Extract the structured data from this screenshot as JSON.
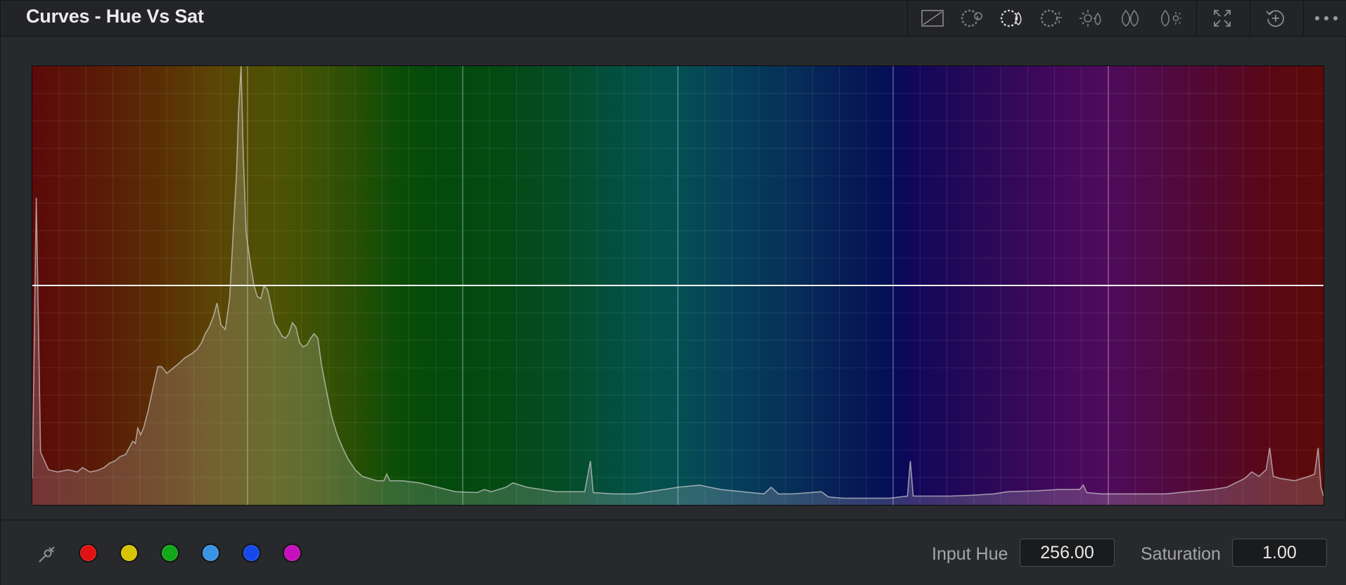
{
  "header": {
    "title": "Curves - Hue Vs Sat",
    "tools": [
      {
        "name": "curve-mode-icon"
      },
      {
        "name": "hue-wheel-icon"
      },
      {
        "name": "hue-sat-icon"
      },
      {
        "name": "hue-lum-icon"
      },
      {
        "name": "lum-sat-icon"
      },
      {
        "name": "sat-sat-icon"
      },
      {
        "name": "sat-lum-icon"
      },
      {
        "name": "expand-icon"
      },
      {
        "name": "reset-icon"
      },
      {
        "name": "more-options-icon"
      }
    ]
  },
  "graph": {
    "curve_level": 0.5,
    "hue_range": [
      0,
      360
    ],
    "grid": true,
    "histogram": [
      {
        "hue": 0,
        "v": 0.06
      },
      {
        "hue": 1.1,
        "v": 0.7
      },
      {
        "hue": 2.3,
        "v": 0.12
      },
      {
        "hue": 4.5,
        "v": 0.08
      },
      {
        "hue": 7,
        "v": 0.075
      },
      {
        "hue": 10,
        "v": 0.08
      },
      {
        "hue": 12.5,
        "v": 0.075
      },
      {
        "hue": 14,
        "v": 0.085
      },
      {
        "hue": 16,
        "v": 0.075
      },
      {
        "hue": 18,
        "v": 0.078
      },
      {
        "hue": 20,
        "v": 0.085
      },
      {
        "hue": 21.5,
        "v": 0.095
      },
      {
        "hue": 23,
        "v": 0.1
      },
      {
        "hue": 24.5,
        "v": 0.11
      },
      {
        "hue": 26,
        "v": 0.115
      },
      {
        "hue": 27,
        "v": 0.13
      },
      {
        "hue": 28,
        "v": 0.145
      },
      {
        "hue": 28.7,
        "v": 0.14
      },
      {
        "hue": 29.4,
        "v": 0.175
      },
      {
        "hue": 30.2,
        "v": 0.16
      },
      {
        "hue": 31,
        "v": 0.175
      },
      {
        "hue": 32.3,
        "v": 0.215
      },
      {
        "hue": 33.6,
        "v": 0.265
      },
      {
        "hue": 35,
        "v": 0.315
      },
      {
        "hue": 36,
        "v": 0.315
      },
      {
        "hue": 37.5,
        "v": 0.3
      },
      {
        "hue": 39,
        "v": 0.31
      },
      {
        "hue": 40.5,
        "v": 0.32
      },
      {
        "hue": 42.5,
        "v": 0.335
      },
      {
        "hue": 44.5,
        "v": 0.345
      },
      {
        "hue": 46,
        "v": 0.355
      },
      {
        "hue": 47.2,
        "v": 0.37
      },
      {
        "hue": 48.2,
        "v": 0.39
      },
      {
        "hue": 49.3,
        "v": 0.405
      },
      {
        "hue": 50.5,
        "v": 0.43
      },
      {
        "hue": 51.5,
        "v": 0.46
      },
      {
        "hue": 52.6,
        "v": 0.41
      },
      {
        "hue": 53.8,
        "v": 0.4
      },
      {
        "hue": 55,
        "v": 0.47
      },
      {
        "hue": 56,
        "v": 0.62
      },
      {
        "hue": 56.9,
        "v": 0.75
      },
      {
        "hue": 57.5,
        "v": 0.9
      },
      {
        "hue": 58.2,
        "v": 1.0
      },
      {
        "hue": 58.8,
        "v": 0.8
      },
      {
        "hue": 59.6,
        "v": 0.62
      },
      {
        "hue": 60.8,
        "v": 0.55
      },
      {
        "hue": 61.8,
        "v": 0.5
      },
      {
        "hue": 62.7,
        "v": 0.475
      },
      {
        "hue": 63.7,
        "v": 0.47
      },
      {
        "hue": 64.6,
        "v": 0.5
      },
      {
        "hue": 65.6,
        "v": 0.49
      },
      {
        "hue": 66.5,
        "v": 0.455
      },
      {
        "hue": 67.5,
        "v": 0.415
      },
      {
        "hue": 68.6,
        "v": 0.4
      },
      {
        "hue": 69.6,
        "v": 0.385
      },
      {
        "hue": 70.6,
        "v": 0.38
      },
      {
        "hue": 71.5,
        "v": 0.39
      },
      {
        "hue": 72.5,
        "v": 0.415
      },
      {
        "hue": 73.5,
        "v": 0.405
      },
      {
        "hue": 74.5,
        "v": 0.37
      },
      {
        "hue": 75.5,
        "v": 0.36
      },
      {
        "hue": 76.6,
        "v": 0.365
      },
      {
        "hue": 77.6,
        "v": 0.38
      },
      {
        "hue": 78.5,
        "v": 0.39
      },
      {
        "hue": 79.6,
        "v": 0.38
      },
      {
        "hue": 80.6,
        "v": 0.32
      },
      {
        "hue": 82,
        "v": 0.26
      },
      {
        "hue": 83.5,
        "v": 0.2
      },
      {
        "hue": 85,
        "v": 0.16
      },
      {
        "hue": 86.5,
        "v": 0.13
      },
      {
        "hue": 88,
        "v": 0.105
      },
      {
        "hue": 90,
        "v": 0.08
      },
      {
        "hue": 92,
        "v": 0.065
      },
      {
        "hue": 94,
        "v": 0.06
      },
      {
        "hue": 96,
        "v": 0.055
      },
      {
        "hue": 98,
        "v": 0.055
      },
      {
        "hue": 98.8,
        "v": 0.07
      },
      {
        "hue": 99.7,
        "v": 0.055
      },
      {
        "hue": 103,
        "v": 0.055
      },
      {
        "hue": 108,
        "v": 0.05
      },
      {
        "hue": 113,
        "v": 0.04
      },
      {
        "hue": 118,
        "v": 0.03
      },
      {
        "hue": 124,
        "v": 0.028
      },
      {
        "hue": 126,
        "v": 0.035
      },
      {
        "hue": 128,
        "v": 0.03
      },
      {
        "hue": 132,
        "v": 0.04
      },
      {
        "hue": 134,
        "v": 0.05
      },
      {
        "hue": 138,
        "v": 0.04
      },
      {
        "hue": 142,
        "v": 0.035
      },
      {
        "hue": 146,
        "v": 0.03
      },
      {
        "hue": 150,
        "v": 0.03
      },
      {
        "hue": 154,
        "v": 0.03
      },
      {
        "hue": 155.6,
        "v": 0.1
      },
      {
        "hue": 156.4,
        "v": 0.028
      },
      {
        "hue": 162,
        "v": 0.025
      },
      {
        "hue": 168,
        "v": 0.025
      },
      {
        "hue": 180,
        "v": 0.04
      },
      {
        "hue": 186,
        "v": 0.045
      },
      {
        "hue": 192,
        "v": 0.035
      },
      {
        "hue": 198,
        "v": 0.03
      },
      {
        "hue": 204,
        "v": 0.025
      },
      {
        "hue": 206,
        "v": 0.04
      },
      {
        "hue": 208,
        "v": 0.025
      },
      {
        "hue": 212,
        "v": 0.025
      },
      {
        "hue": 220,
        "v": 0.03
      },
      {
        "hue": 222,
        "v": 0.018
      },
      {
        "hue": 226,
        "v": 0.015
      },
      {
        "hue": 234,
        "v": 0.015
      },
      {
        "hue": 239,
        "v": 0.015
      },
      {
        "hue": 244,
        "v": 0.02
      },
      {
        "hue": 244.8,
        "v": 0.1
      },
      {
        "hue": 245.6,
        "v": 0.02
      },
      {
        "hue": 250,
        "v": 0.02
      },
      {
        "hue": 256,
        "v": 0.02
      },
      {
        "hue": 262,
        "v": 0.022
      },
      {
        "hue": 268,
        "v": 0.025
      },
      {
        "hue": 272,
        "v": 0.03
      },
      {
        "hue": 280,
        "v": 0.032
      },
      {
        "hue": 286,
        "v": 0.035
      },
      {
        "hue": 292,
        "v": 0.035
      },
      {
        "hue": 293,
        "v": 0.045
      },
      {
        "hue": 294,
        "v": 0.028
      },
      {
        "hue": 298,
        "v": 0.025
      },
      {
        "hue": 304,
        "v": 0.025
      },
      {
        "hue": 310,
        "v": 0.025
      },
      {
        "hue": 316,
        "v": 0.025
      },
      {
        "hue": 322,
        "v": 0.03
      },
      {
        "hue": 329,
        "v": 0.035
      },
      {
        "hue": 333,
        "v": 0.04
      },
      {
        "hue": 338,
        "v": 0.06
      },
      {
        "hue": 340,
        "v": 0.075
      },
      {
        "hue": 342,
        "v": 0.065
      },
      {
        "hue": 344,
        "v": 0.08
      },
      {
        "hue": 345,
        "v": 0.13
      },
      {
        "hue": 346,
        "v": 0.065
      },
      {
        "hue": 348,
        "v": 0.06
      },
      {
        "hue": 352,
        "v": 0.055
      },
      {
        "hue": 356,
        "v": 0.065
      },
      {
        "hue": 357.5,
        "v": 0.07
      },
      {
        "hue": 358.5,
        "v": 0.13
      },
      {
        "hue": 359.3,
        "v": 0.04
      },
      {
        "hue": 360,
        "v": 0.02
      }
    ]
  },
  "footer": {
    "picker_icon": "eyedropper-icon",
    "swatches": [
      {
        "name": "red",
        "color": "#e01214"
      },
      {
        "name": "yellow",
        "color": "#d6c403"
      },
      {
        "name": "green",
        "color": "#12a81a"
      },
      {
        "name": "cyan",
        "color": "#3a94e6"
      },
      {
        "name": "blue",
        "color": "#1549ea"
      },
      {
        "name": "magenta",
        "color": "#c80fbd"
      }
    ],
    "input_hue_label": "Input Hue",
    "input_hue_value": "256.00",
    "saturation_label": "Saturation",
    "saturation_value": "1.00"
  }
}
